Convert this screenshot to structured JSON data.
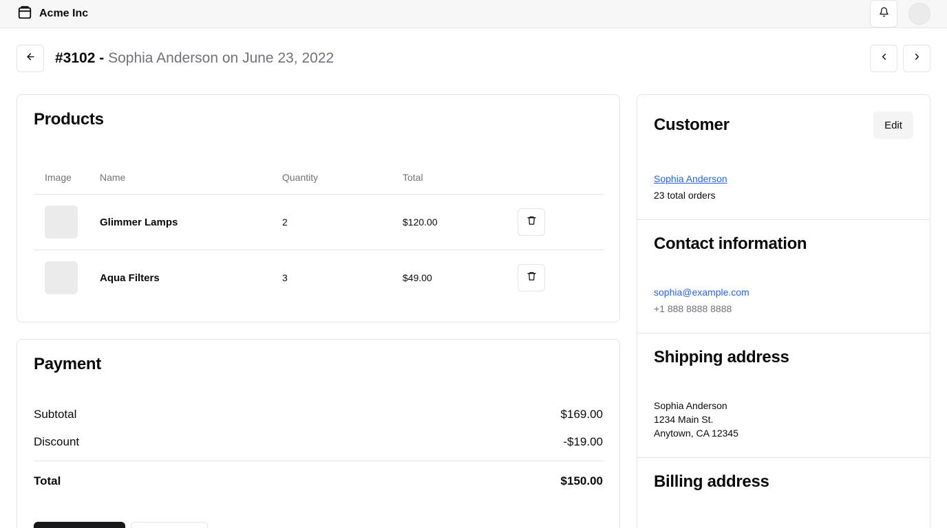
{
  "brand": {
    "name": "Acme Inc",
    "icon": "package-icon"
  },
  "header_icons": {
    "notifications": "bell-icon",
    "avatar": "user-avatar"
  },
  "order": {
    "number": "#3102",
    "separator": " - ",
    "subtitle": "Sophia Anderson on June 23, 2022"
  },
  "nav": {
    "back": "arrow-left-icon",
    "prev": "chevron-left-icon",
    "next": "chevron-right-icon"
  },
  "products": {
    "title": "Products",
    "columns": [
      "Image",
      "Name",
      "Quantity",
      "Total"
    ],
    "rows": [
      {
        "name": "Glimmer Lamps",
        "quantity": "2",
        "total": "$120.00"
      },
      {
        "name": "Aqua Filters",
        "quantity": "3",
        "total": "$49.00"
      }
    ]
  },
  "payment": {
    "title": "Payment",
    "subtotal_label": "Subtotal",
    "subtotal_value": "$169.00",
    "discount_label": "Discount",
    "discount_value": "-$19.00",
    "total_label": "Total",
    "total_value": "$150.00"
  },
  "customer": {
    "title": "Customer",
    "edit_label": "Edit",
    "name": "Sophia Anderson",
    "orders": "23 total orders"
  },
  "contact": {
    "title": "Contact information",
    "email": "sophia@example.com",
    "phone": "+1 888 8888 8888"
  },
  "shipping": {
    "title": "Shipping address",
    "name": "Sophia Anderson",
    "street": "1234 Main St.",
    "city": "Anytown, CA 12345"
  },
  "billing": {
    "title": "Billing address"
  },
  "colors": {
    "accent": "#2563eb",
    "border": "#e4e4e7",
    "muted": "#71717a",
    "dark": "#18181b"
  }
}
